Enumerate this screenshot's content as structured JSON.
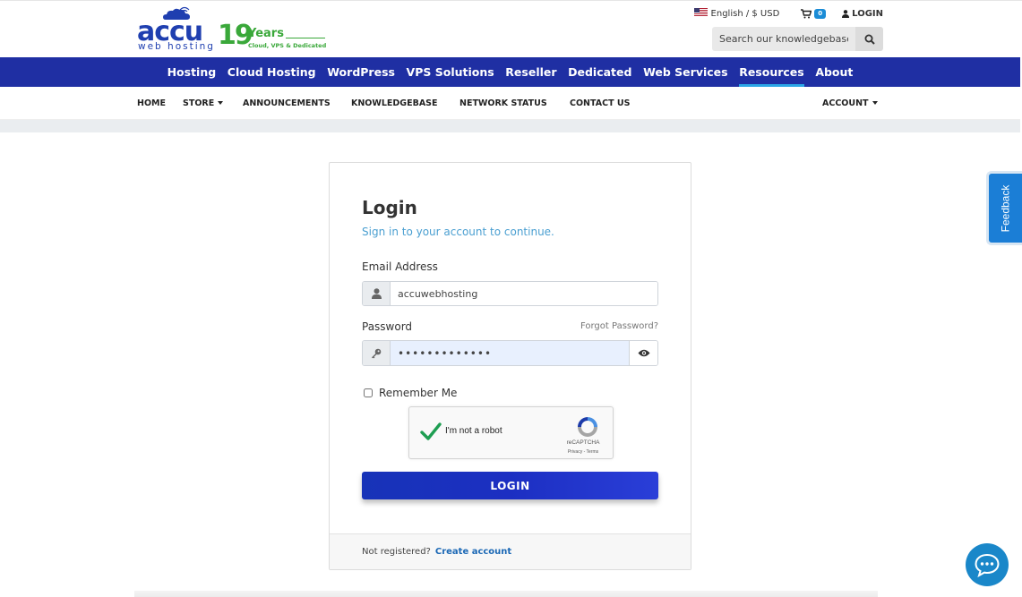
{
  "logo": {
    "brand": "accu",
    "tagline": "web hosting",
    "years_number": "19",
    "years_label": "Years",
    "years_sub": "Cloud, VPS & Dedicated"
  },
  "topbar": {
    "language": "English / $ USD",
    "cart_count": "0",
    "login_label": "LOGIN",
    "search_placeholder": "Search our knowledgebase..."
  },
  "main_nav": {
    "items": [
      {
        "label": "Hosting"
      },
      {
        "label": "Cloud Hosting"
      },
      {
        "label": "WordPress"
      },
      {
        "label": "VPS Solutions"
      },
      {
        "label": "Reseller"
      },
      {
        "label": "Dedicated"
      },
      {
        "label": "Web Services"
      },
      {
        "label": "Resources"
      },
      {
        "label": "About"
      }
    ],
    "active": "Resources"
  },
  "sub_nav": {
    "home": "HOME",
    "store": "STORE",
    "announcements": "ANNOUNCEMENTS",
    "knowledgebase": "KNOWLEDGEBASE",
    "network_status": "NETWORK STATUS",
    "contact_us": "CONTACT US",
    "account": "ACCOUNT"
  },
  "login": {
    "title": "Login",
    "subtitle": "Sign in to your account to continue.",
    "email_label": "Email Address",
    "email_value": "accuwebhosting",
    "password_label": "Password",
    "forgot_label": "Forgot Password?",
    "password_value": "•••••••••••••",
    "remember_label": "Remember Me",
    "button_label": "LOGIN",
    "not_registered": "Not registered?",
    "create_account": "Create account"
  },
  "recaptcha": {
    "label": "I'm not a robot",
    "brand": "reCAPTCHA",
    "terms": "Privacy - Terms"
  },
  "feedback": {
    "label": "Feedback"
  },
  "colors": {
    "nav_bg": "#1f2fa3",
    "accent": "#2ba6e6",
    "button": "#1c2fc2",
    "link": "#1b68b5"
  }
}
